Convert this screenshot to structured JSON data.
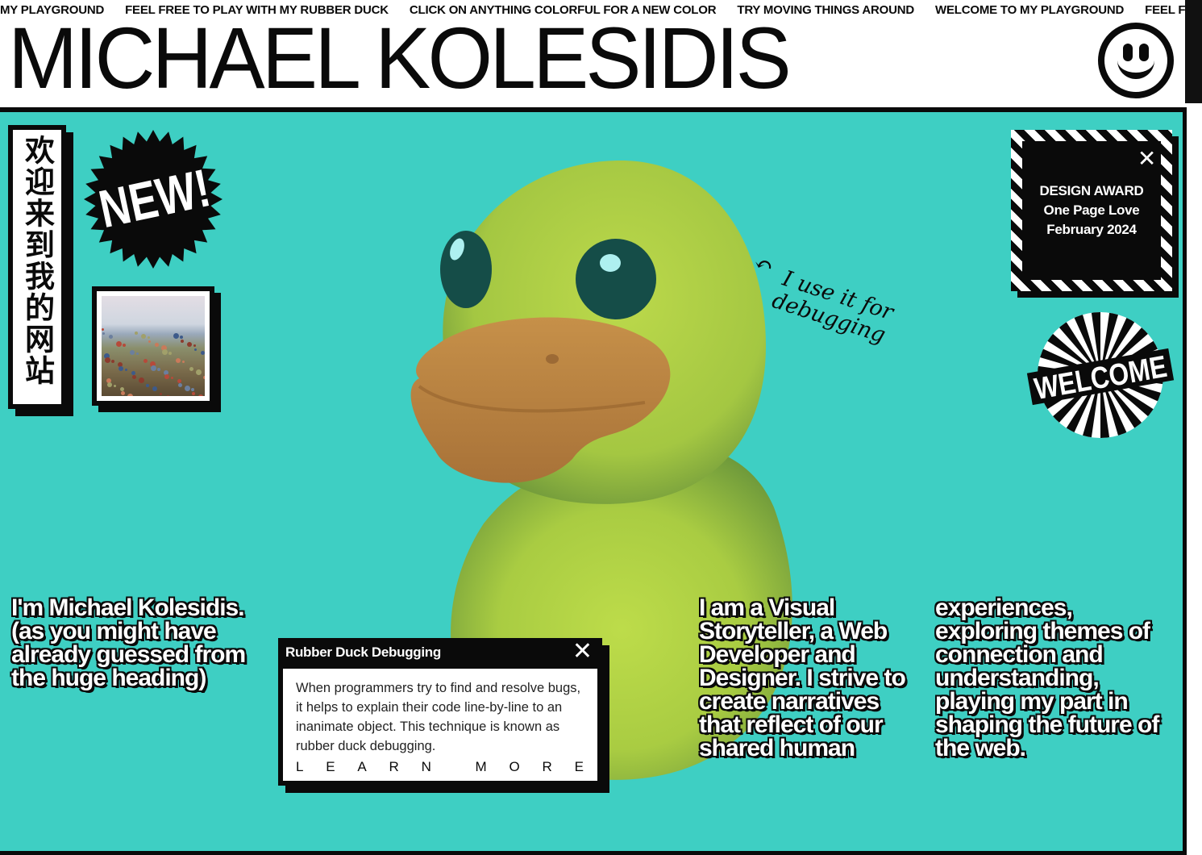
{
  "marquee": {
    "items": [
      "MY PLAYGROUND",
      "FEEL FREE TO PLAY WITH MY RUBBER DUCK",
      "CLICK ON ANYTHING COLORFUL FOR A NEW COLOR",
      "TRY MOVING THINGS AROUND",
      "WELCOME TO MY PLAYGROUND",
      "FEEL FREE TO PLAY WITH MY RUBBER DUCK"
    ]
  },
  "header": {
    "title": "MICHAEL KOLESIDIS"
  },
  "colors": {
    "background": "#3ecfc3",
    "ink": "#0a0a0a",
    "duck": "#b6d63f",
    "beak": "#c9924c"
  },
  "stickers": {
    "chinese_banner": "欢迎来到我的网站",
    "new_badge": "NEW!",
    "welcome_badge": "WELCOME"
  },
  "annotation": {
    "line1": "I use it for",
    "line2": "debugging"
  },
  "award": {
    "line1": "DESIGN AWARD",
    "line2": "One Page Love",
    "line3": "February 2024",
    "close": "✕"
  },
  "intro": {
    "text": "I'm Michael Kolesidis. (as you might have already guessed from the huge heading)"
  },
  "bio": {
    "part1": "I am a Visual Storyteller, a Web Developer and Designer. I strive to create narratives that reflect of our shared human",
    "part2": "experiences, exploring themes of connection and understanding, playing my part in shaping the future of the web."
  },
  "popup": {
    "title": "Rubber Duck Debugging",
    "close": "✕",
    "body": "When programmers try to find and resolve bugs, it helps to explain their code line-by-line to an inanimate object. This technique is known as rubber duck debugging.",
    "link_letters": [
      "L",
      "E",
      "A",
      "R",
      "N",
      " ",
      "M",
      "O",
      "R",
      "E"
    ]
  }
}
